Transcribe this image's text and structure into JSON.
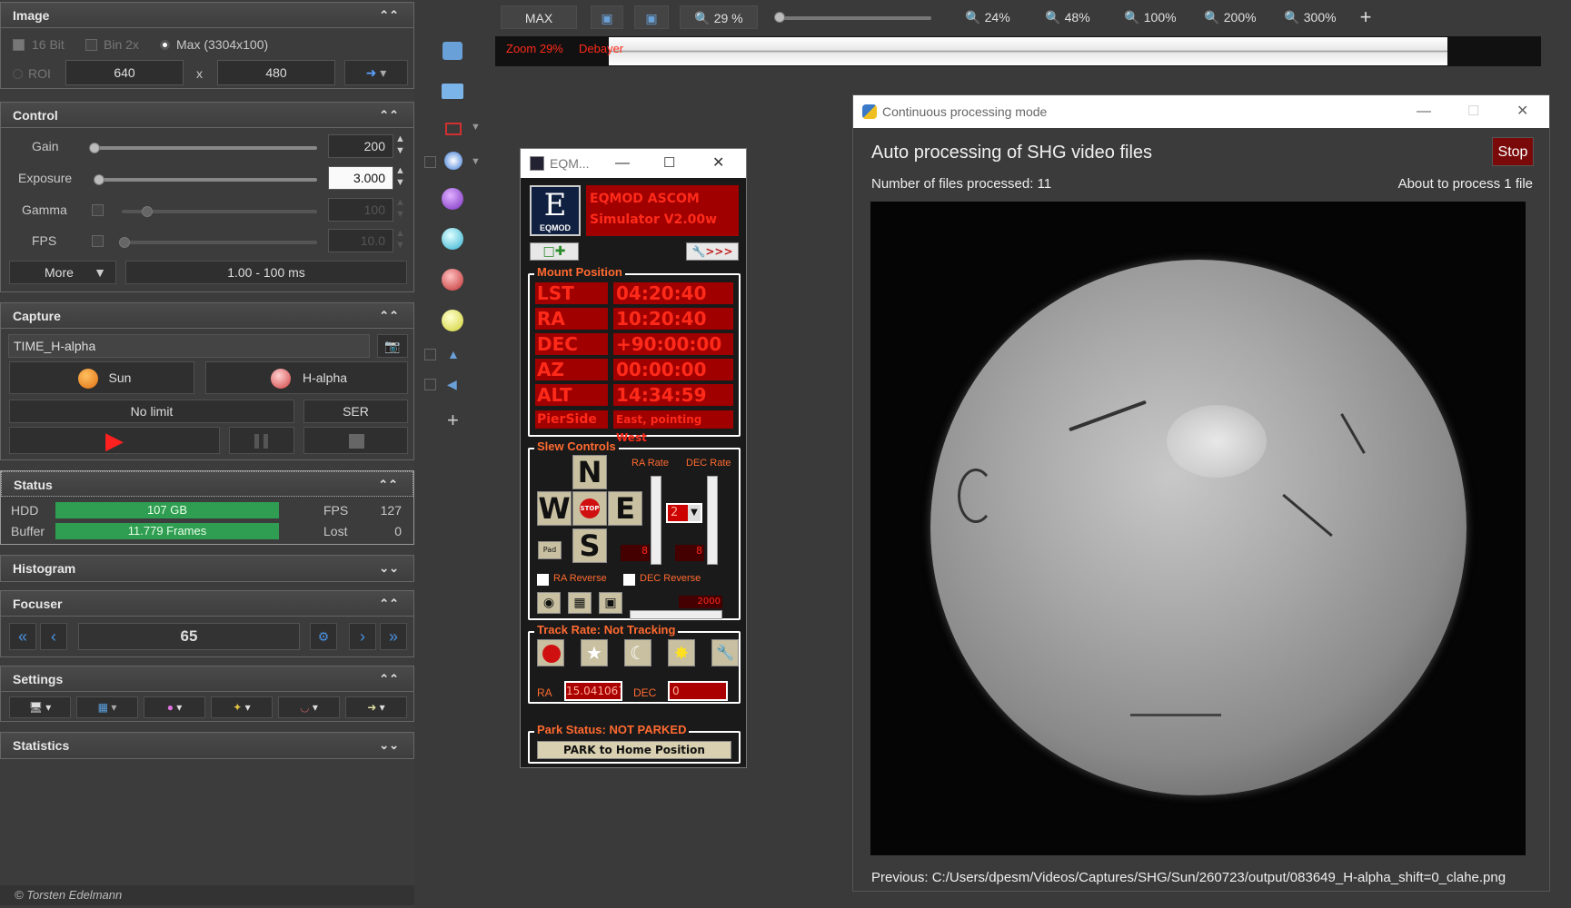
{
  "image_section": {
    "title": "Image",
    "bit16": "16 Bit",
    "bin2x": "Bin 2x",
    "max": "Max (3304x100)",
    "roi": "ROI",
    "roi_w": "640",
    "roi_x": "x",
    "roi_h": "480"
  },
  "control_section": {
    "title": "Control",
    "gain_label": "Gain",
    "gain_value": "200",
    "gain_level": 0.0,
    "exposure_label": "Exposure",
    "exposure_value": "3.000",
    "exposure_level": 0.0,
    "gamma_label": "Gamma",
    "gamma_value": "100",
    "gamma_level": 0.1,
    "fps_label": "FPS",
    "fps_value": "10.0",
    "fps_level": 0.0,
    "more_label": "More",
    "range_label": "1.00 - 100 ms"
  },
  "capture_section": {
    "title": "Capture",
    "filename": "TIME_H-alpha",
    "object1": "Sun",
    "object2": "H-alpha",
    "limit": "No limit",
    "format": "SER"
  },
  "status_section": {
    "title": "Status",
    "hdd_label": "HDD",
    "hdd_value": "107 GB",
    "fps_label": "FPS",
    "fps_value": "127",
    "buffer_label": "Buffer",
    "buffer_value": "11.779 Frames",
    "lost_label": "Lost",
    "lost_value": "0"
  },
  "histogram_section": {
    "title": "Histogram"
  },
  "focuser_section": {
    "title": "Focuser",
    "position": "65"
  },
  "settings_section": {
    "title": "Settings"
  },
  "statistics_section": {
    "title": "Statistics"
  },
  "copyright": "© Torsten Edelmann",
  "topbar": {
    "max": "MAX",
    "zoom_current": "29 %",
    "zoom_levels": [
      "24%",
      "48%",
      "100%",
      "200%",
      "300%"
    ],
    "plus": "+"
  },
  "preview": {
    "zoom_text": "Zoom 29%",
    "debayer_text": "Debayer"
  },
  "eqmod": {
    "window_title": "EQM...",
    "logo_text": "EQMOD",
    "banner": "EQMOD ASCOM Simulator V2.00w",
    "mount_position_label": "Mount Position",
    "rows": [
      {
        "label": "LST",
        "value": "04:20:40"
      },
      {
        "label": "RA",
        "value": "10:20:40"
      },
      {
        "label": "DEC",
        "value": "+90:00:00"
      },
      {
        "label": "AZ",
        "value": "00:00:00"
      },
      {
        "label": "ALT",
        "value": "14:34:59"
      }
    ],
    "pierside_label": "PierSide",
    "pierside_value": "East, pointing West",
    "slew_label": "Slew Controls",
    "ra_rate_label": "RA Rate",
    "dec_rate_label": "DEC Rate",
    "north": "N",
    "west": "W",
    "east": "E",
    "south": "S",
    "stop": "STOP",
    "pad": "Pad",
    "rate_select": "2",
    "ra_rate_value": "8",
    "dec_rate_value": "8",
    "ra_reverse": "RA Reverse",
    "dec_reverse": "DEC Reverse",
    "speed_value": "2000",
    "track_label": "Track Rate: Not Tracking",
    "track_ra_label": "RA",
    "track_ra_value": "15.041067",
    "track_dec_label": "DEC",
    "track_dec_value": "0",
    "park_label": "Park Status: NOT PARKED",
    "park_button": "PARK to Home Position"
  },
  "processing": {
    "window_title": "Continuous processing mode",
    "heading": "Auto processing of SHG video files",
    "stop": "Stop",
    "files_processed": "Number of files processed: 11",
    "about_to_process": "About to process 1 file",
    "previous": "Previous: C:/Users/dpesm/Videos/Captures/SHG/Sun/260723/output/083649_H-alpha_shift=0_clahe.png"
  }
}
